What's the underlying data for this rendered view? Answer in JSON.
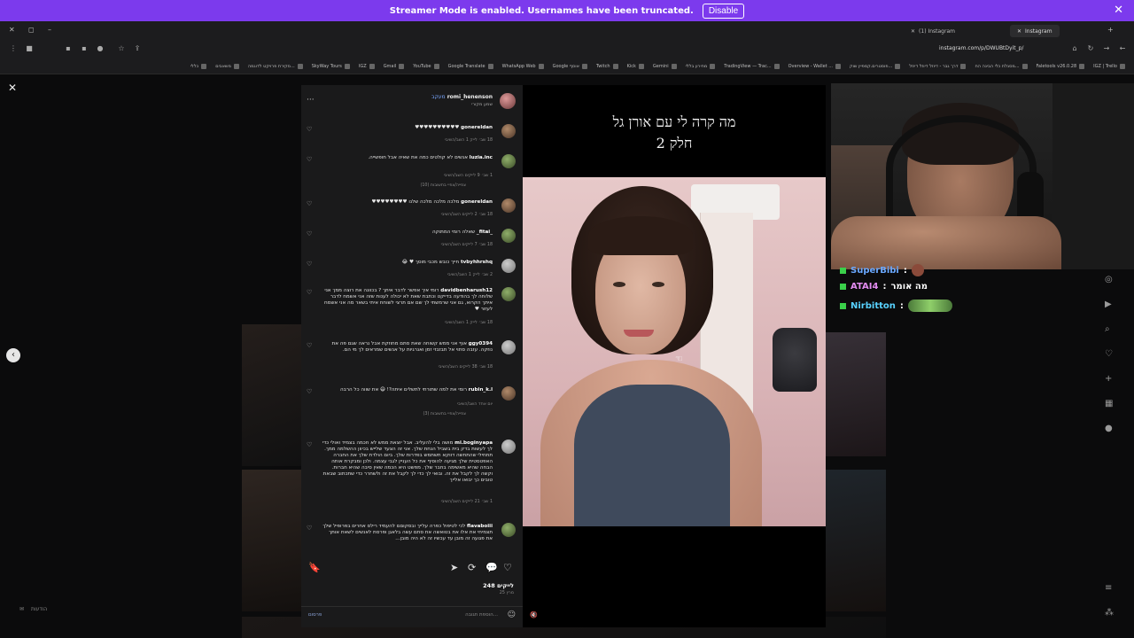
{
  "streamer_bar": {
    "message": "Streamer Mode is enabled. Usernames have been truncated.",
    "disable_label": "Disable",
    "close": "✕"
  },
  "browser": {
    "tabs": [
      {
        "label": "(1) Instagram"
      },
      {
        "label": "Instagram"
      }
    ],
    "url": "instagram.com/p/DWUBtDyit_p/",
    "bookmarks": [
      "IGZ | Trello",
      "Faletools v26.0.28",
      "מסגלת כלי הבינה הח...",
      "דרך גבר - דיוזל דיוזל דיוזל",
      "פוסטרים.קמפיין שוק...",
      "Overview - Wallet ...",
      "TradingView — Trac...",
      "מחירון בללי",
      "Gemini",
      "Kick",
      "Twitch",
      "Google אוסף",
      "WhatsApp Web",
      "Google Translate",
      "YouTube",
      "Gmail",
      "IGZ",
      "SkyWay Tours",
      "סקירת פרויקט לדוגמה...",
      "משאבים",
      "כללי"
    ]
  },
  "post": {
    "author": "romi_henenson",
    "follow_label": "מעקב",
    "author_subtitle": "שמע מקורי",
    "comments": [
      {
        "user": "gonereldan",
        "text": "♥♥♥♥♥♥♥♥♥♥",
        "meta": "18 שב׳   לייק 1   השב/השיבי"
      },
      {
        "user": "luzia.inc",
        "text": "אנשים לא קולטים כמה את שאיה אבל חופשייה.",
        "meta": "1 שב׳   9 לייקים   השב/השיבי",
        "replies": "צפייה/צפיי בתשובות (10)"
      },
      {
        "user": "gonereldan",
        "text": "מלכה מלכה מלכה שלנו ♥♥♥♥♥♥♥♥",
        "meta": "18 שב׳   2 לייקים   השב/השיבי"
      },
      {
        "user": "_fitai_",
        "text": "שאלה רומי המתוקה",
        "meta": "18 שב׳   7 לייקים   השב/השיבי"
      },
      {
        "user": "tvbyhhrshq",
        "text": "חייך כובש מכבי מוסך ♥ 😂",
        "meta": "2 שב׳   לייק 1   השב/השיבי"
      },
      {
        "user": "davidbenharush12",
        "text": "רומי איך אפשר לדבר איתך ? בכוונה את רוצה ממך אני שלוחה לך בהודעה בדייקט וכתבת שאת לא יכולה לענות שזה אני אשמח לדבר איתך הקרוא, גם אני שרמשתי לך שם אם תרצי לשוחח איתי בשאר מה אני אשמח לעזור ♥",
        "meta": "18 שב׳   לייק 1   השב/השיבי"
      },
      {
        "user": "ggy0394",
        "text": "אוף אני ממש קשוחה שאת סתם מחוזקת אבל נראה שגם פה את נוזקה. עזבה סתוי אל תבזבזי זמן ואנרגיות על אנשים שמראים לך מי הם.",
        "meta": "18 שב׳   38 לייקים   השב/השיבי"
      },
      {
        "user": "rubin_k.l",
        "text": "רומי את למה שתורתי לתשלים איתה?! 😄 את שווה כל הרבה",
        "meta": "יום אחד   השב/השיבי",
        "replies": "צפייה/צפיי בתשובות (3)"
      },
      {
        "user": "mi.boginyapa",
        "text": "מושה בלי להעליב. אבל יוצאת ממש לא חכמה בצמיד ואולי כדי לך לעשות בדק בית בשביל הנחת שלך. אני זה הצעד שלייש בכיוון ההשלמה ממך. תתחילי שהתחשה דווקא תשתמש בפדרות שלך. ביום הולדת שלך את החברה האפטסטית שלך מגיעה להוסיף את כל העניין לגבי עצמה. ולכן ומבקרת אותה הבחה שהיא מאשימה בחבר שלך. מפשט היא הכמה שאין סיבה שהיא חברות. וקשה לך לקבל את זה. ובואי לך כדי לך לקבל את זה ולשחרר כדי שתכתוב שבאת טובים כך יבואו אלייך",
        "meta": "1 שב׳   21 לייקים   השב/השיבי"
      },
      {
        "user": "flavaboiii",
        "text": "לכי לטיפול כפרה עלייך ובסקוםם להעמיד רילס אחרים בפרופיל שלך תצמיחי את אלו את בטואשה את סתם עשה בלאגן ופרסת לאנשים לשאת אותך את פגועה זה מובן עד עכשיו זה לא היה מובן...",
        "meta": ""
      }
    ],
    "likes": "248 לייקים",
    "date": "25 מרץ",
    "comment_placeholder": "הוספת תגובה...",
    "post_label": "פרסום"
  },
  "video": {
    "caption_line1": "מה קרה לי עם אורן גל",
    "caption_line2": "חלק 2"
  },
  "chat": [
    {
      "user": "SuperBibi",
      "text": ""
    },
    {
      "user": "ATAI4",
      "text": "מה אומר"
    },
    {
      "user": "Nirbitton",
      "text": ""
    }
  ],
  "lower_left": "הודעות",
  "icons": {
    "close": "✕",
    "more": "···",
    "heart": "♡",
    "bookmark": "🔖",
    "share": "➤",
    "repost": "⟳",
    "comment": "💬",
    "emoji": "☺",
    "prev": "‹",
    "mute": "🔇",
    "cursor": "☜"
  }
}
